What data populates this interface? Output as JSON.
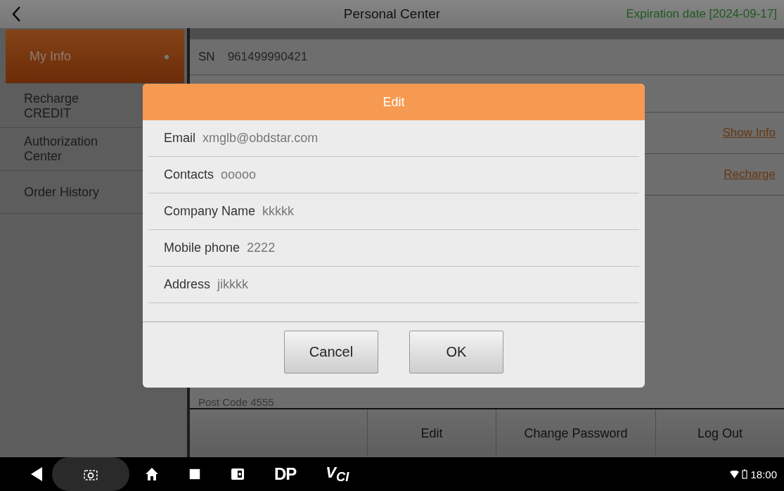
{
  "header": {
    "title": "Personal Center",
    "expiration": "Expiration date [2024-09-17]"
  },
  "sidebar": {
    "items": [
      {
        "label": "My Info",
        "selected": true
      },
      {
        "label": "Recharge CREDIT",
        "selected": false
      },
      {
        "label": "Authorization Center",
        "selected": false
      },
      {
        "label": "Order History",
        "selected": false
      }
    ]
  },
  "main": {
    "sn": {
      "label": "SN",
      "value": "961499990421"
    },
    "links": [
      "Show Info",
      "Recharge"
    ],
    "post_code": "Post Code 4555",
    "actions": [
      "Edit",
      "Change Password",
      "Log Out"
    ]
  },
  "dialog": {
    "title": "Edit",
    "fields": [
      {
        "label": "Email",
        "value": "xmglb@obdstar.com"
      },
      {
        "label": "Contacts",
        "value": "ooooo"
      },
      {
        "label": "Company Name",
        "value": "kkkkk"
      },
      {
        "label": "Mobile phone",
        "value": "2222"
      },
      {
        "label": "Address",
        "value": "jikkkk"
      }
    ],
    "buttons": [
      "Cancel",
      "OK"
    ]
  },
  "navbar": {
    "apps": [
      "DP",
      "V$_{CI}$"
    ],
    "time": "18:00"
  }
}
